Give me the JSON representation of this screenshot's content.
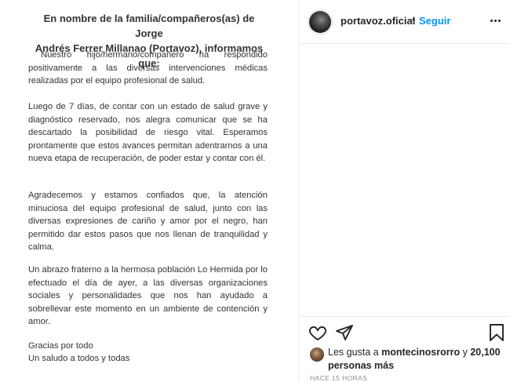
{
  "post_image": {
    "title_line1": "En nombre de la familia/compañeros(as) de Jorge",
    "title_line2": "Andrés Ferrer Millanao (Portavoz), informamos que:",
    "paragraph1": "Nuestro hijo/hermano/compañero ha respondido positivamente a las diversas intervenciones médicas realizadas por el equipo profesional de salud.",
    "paragraph2": "Luego de 7 días, de contar con un estado de salud grave y diagnóstico reservado, nos alegra comunicar que se ha descartado la posibilidad de riesgo vital. Esperamos prontamente que estos avances permitan adentrarnos a una nueva etapa de recuperación, de poder estar y contar con él.",
    "paragraph3": "Agradecemos y estamos confiados que, la atención minuciosa del equipo profesional de salud, junto con las diversas expresiones de cariño y amor por el negro, han permitido dar estos pasos que nos llenan de tranquilidad y calma.",
    "paragraph4": "Un abrazo fraterno a la hermosa población Lo Hermida por lo efectuado el día de ayer, a las diversas organizaciones sociales y personalidades que nos han ayudado a sobrellevar este momento en un ambiente de contención y amor.",
    "closing1": "Gracias por todo",
    "closing2": "Un saludo a todos y todas"
  },
  "header": {
    "username": "portavoz.oficial",
    "separator": "•",
    "follow_label": "Seguir"
  },
  "likes": {
    "prefix": "Les gusta a ",
    "user": "montecinosrorro",
    "middle": " y ",
    "count": "20,100 personas más"
  },
  "timestamp": "HACE 15 HORAS",
  "colors": {
    "follow_blue": "#0095f6",
    "text": "#262626",
    "muted": "#8e8e8e",
    "border": "#efefef"
  },
  "icons": {
    "more": "more-options-icon",
    "like": "heart-icon",
    "share": "paper-plane-icon",
    "save": "bookmark-icon"
  }
}
